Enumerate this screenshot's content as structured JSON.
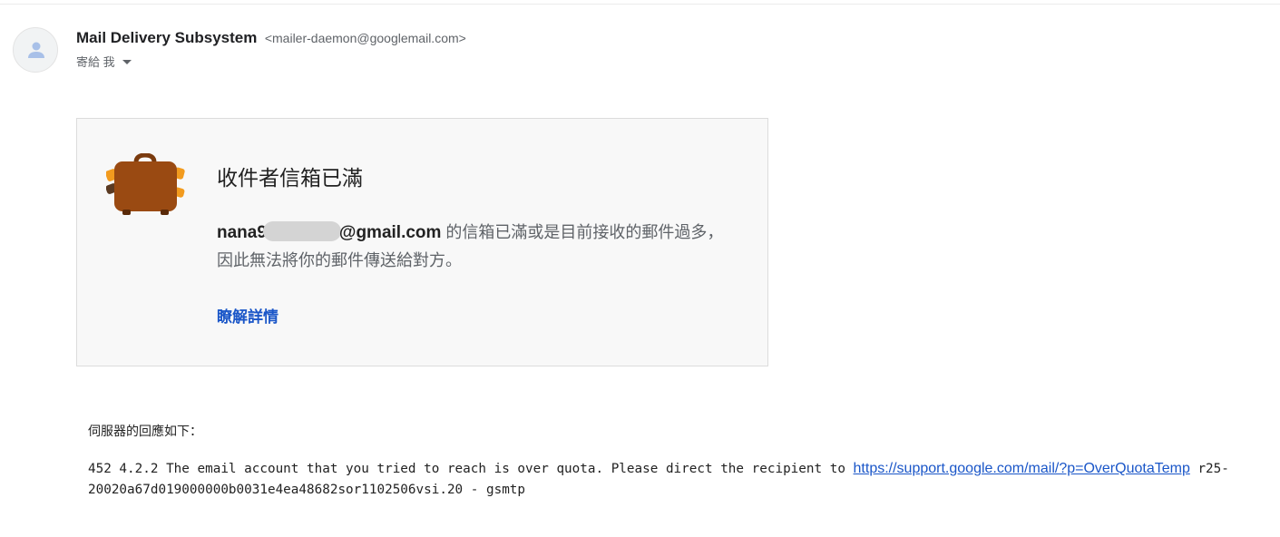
{
  "header": {
    "sender_name": "Mail Delivery Subsystem",
    "sender_email": "<mailer-daemon@googlemail.com>",
    "recipient_label": "寄給 我",
    "avatar_icon": "person-icon"
  },
  "card": {
    "icon": "suitcase-icon",
    "title": "收件者信箱已滿",
    "address_prefix": "nana9",
    "address_suffix": "@gmail.com",
    "message_line1": " 的信箱已滿或是目前接收的郵件過多，",
    "message_line2": "因此無法將你的郵件傳送給對方。",
    "learn_more": "瞭解詳情"
  },
  "server": {
    "label": "伺服器的回應如下：",
    "msg_before": "452 4.2.2 The email account that you tried to reach is over quota. Please direct the recipient to ",
    "link_text": "https://support.google.com/mail/?p=OverQuotaTemp",
    "msg_after": " r25-20020a67d019000000b0031e4ea48682sor1102506vsi.20 - gsmtp"
  },
  "colors": {
    "link": "#1a56c8",
    "suitcase": "#9a4a12",
    "suitcase_handle": "#f29b1e"
  }
}
